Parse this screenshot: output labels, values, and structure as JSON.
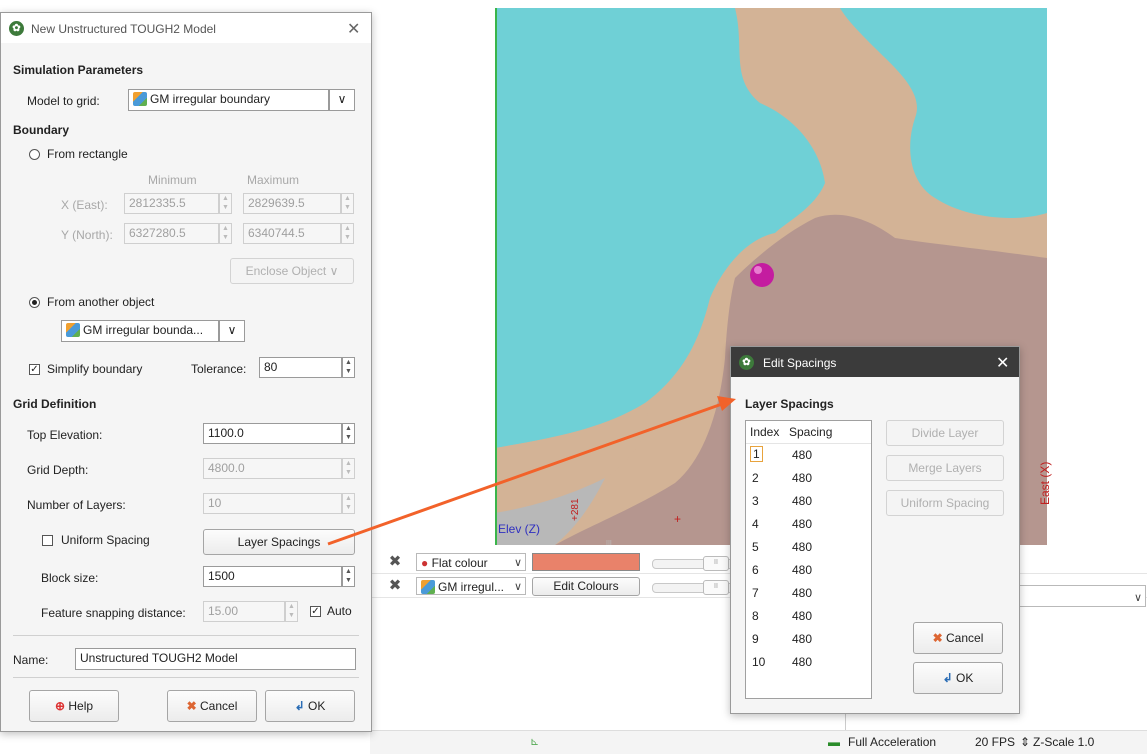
{
  "viewport": {
    "axis_elev": "Elev (Z)",
    "axis_east": "East (X)",
    "tick_281": "+281",
    "tick_mid": "+",
    "tick_marker": "III"
  },
  "layers": [
    {
      "type_label": "Flat colour",
      "action_kind": "swatch",
      "swatch_color": "#e9826a"
    },
    {
      "type_label": "GM irregul...",
      "action_kind": "button",
      "action_label": "Edit Colours"
    }
  ],
  "status_bar": {
    "acceleration": "Full Acceleration",
    "fps": "20 FPS",
    "zscale": "Z-Scale 1.0"
  },
  "main_dialog": {
    "title": "New Unstructured TOUGH2 Model",
    "sim_params_heading": "Simulation Parameters",
    "model_to_grid_label": "Model to grid:",
    "model_to_grid_value": "GM irregular boundary",
    "boundary_heading": "Boundary",
    "from_rectangle_label": "From rectangle",
    "min_header": "Minimum",
    "max_header": "Maximum",
    "x_label": "X (East):",
    "x_min": "2812335.5",
    "x_max": "2829639.5",
    "y_label": "Y (North):",
    "y_min": "6327280.5",
    "y_max": "6340744.5",
    "enclose_object_label": "Enclose Object",
    "from_object_label": "From another object",
    "object_value": "GM irregular bounda...",
    "simplify_label": "Simplify boundary",
    "tolerance_label": "Tolerance:",
    "tolerance_value": "80",
    "grid_def_heading": "Grid Definition",
    "top_elev_label": "Top Elevation:",
    "top_elev_value": "1100.0",
    "grid_depth_label": "Grid Depth:",
    "grid_depth_value": "4800.0",
    "num_layers_label": "Number of Layers:",
    "num_layers_value": "10",
    "uniform_spacing_label": "Uniform Spacing",
    "layer_spacings_label": "Layer Spacings",
    "block_size_label": "Block size:",
    "block_size_value": "1500",
    "snap_label": "Feature snapping distance:",
    "snap_value": "15.00",
    "auto_label": "Auto",
    "name_label": "Name:",
    "name_value": "Unstructured TOUGH2 Model",
    "help_label": "Help",
    "cancel_label": "Cancel",
    "ok_label": "OK"
  },
  "edit_dialog": {
    "title": "Edit Spacings",
    "heading": "Layer Spacings",
    "col_index": "Index",
    "col_spacing": "Spacing",
    "rows": [
      {
        "index": "1",
        "spacing": "480"
      },
      {
        "index": "2",
        "spacing": "480"
      },
      {
        "index": "3",
        "spacing": "480"
      },
      {
        "index": "4",
        "spacing": "480"
      },
      {
        "index": "5",
        "spacing": "480"
      },
      {
        "index": "6",
        "spacing": "480"
      },
      {
        "index": "7",
        "spacing": "480"
      },
      {
        "index": "8",
        "spacing": "480"
      },
      {
        "index": "9",
        "spacing": "480"
      },
      {
        "index": "10",
        "spacing": "480"
      }
    ],
    "divide_label": "Divide Layer",
    "merge_label": "Merge Layers",
    "uniform_label": "Uniform Spacing",
    "cancel_label": "Cancel",
    "ok_label": "OK"
  },
  "colors": {
    "water": "#6fd0d6",
    "land": "#d3b396",
    "mountain": "#b5968f",
    "sphere": "#c41ca0",
    "arrow": "#f2622a"
  }
}
